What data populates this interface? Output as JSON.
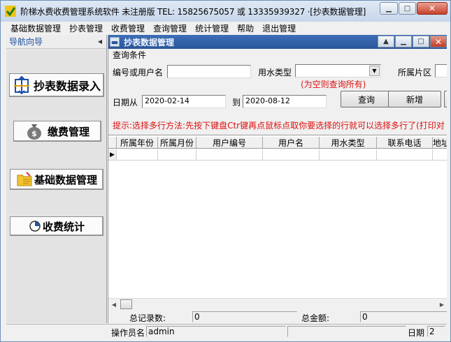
{
  "window": {
    "title": "阶梯水费收费管理系统软件 未注册版 TEL: 15825675057 或 13335939327 ·[抄表数据管理]"
  },
  "menu": [
    "基础数据管理",
    "抄表管理",
    "收费管理",
    "查询管理",
    "统计管理",
    "帮助",
    "退出管理"
  ],
  "sidebar": {
    "header": "导航向导",
    "items": [
      {
        "label": "抄表数据录入"
      },
      {
        "label": "缴费管理"
      },
      {
        "label": "基础数据管理"
      },
      {
        "label": "收费统计"
      }
    ]
  },
  "child": {
    "title": "抄表数据管理",
    "group": "查询条件",
    "labels": {
      "user": "编号或用户名",
      "water_type": "用水类型",
      "area": "所属片区",
      "date_from": "日期从",
      "date_to": "到"
    },
    "hint_empty": "(为空则查询所有)",
    "date_from": "2020-02-14",
    "date_to": "2020-08-12",
    "buttons": {
      "query": "查询",
      "add": "新增"
    },
    "tip": "提示:选择多行方法:先按下键盘Ctr键再点鼠标点取你要选择的行就可以选择多行了(打印对"
  },
  "grid": {
    "columns": [
      "所属年份",
      "所属月份",
      "用户编号",
      "用户名",
      "用水类型",
      "联系电话",
      "地址"
    ]
  },
  "totals": {
    "records_label": "总记录数:",
    "records": "0",
    "amount_label": "总金额:",
    "amount": "0"
  },
  "status": {
    "operator_label": "操作员名",
    "operator": "admin",
    "date_label": "日期",
    "date_value": "2"
  },
  "colors": {
    "accent": "#2b5597",
    "red_text": "#dd1111",
    "nav_blue": "#1a4fa0"
  }
}
